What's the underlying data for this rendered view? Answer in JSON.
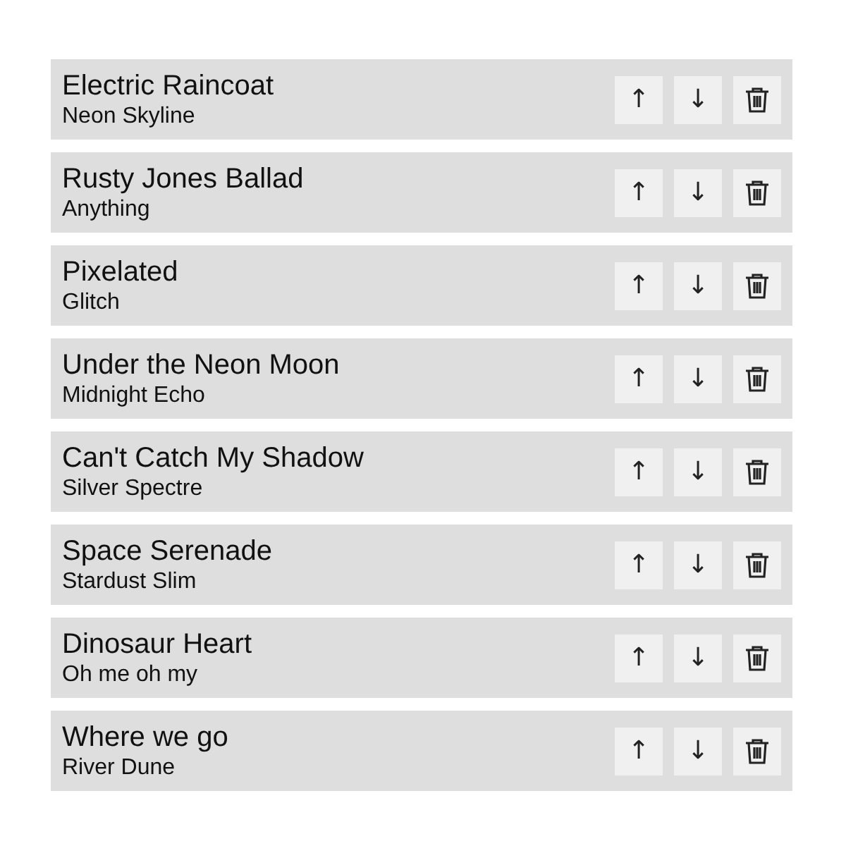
{
  "songs": [
    {
      "title": "Electric Raincoat",
      "artist": "Neon Skyline",
      "up": "↑",
      "down": "↓"
    },
    {
      "title": "Rusty Jones Ballad",
      "artist": "Anything",
      "up": "↑",
      "down": "↓"
    },
    {
      "title": "Pixelated",
      "artist": "Glitch",
      "up": "↑",
      "down": "↓"
    },
    {
      "title": "Under the Neon Moon",
      "artist": "Midnight Echo",
      "up": "↑",
      "down": "↓"
    },
    {
      "title": "Can't Catch My Shadow",
      "artist": "Silver Spectre",
      "up": "↑",
      "down": "↓"
    },
    {
      "title": "Space Serenade",
      "artist": "Stardust Slim",
      "up": "↑",
      "down": "↓"
    },
    {
      "title": "Dinosaur Heart",
      "artist": "Oh me oh my",
      "up": "↑",
      "down": "↓"
    },
    {
      "title": "Where we go",
      "artist": "River Dune",
      "up": "↑",
      "down": "↓"
    }
  ]
}
